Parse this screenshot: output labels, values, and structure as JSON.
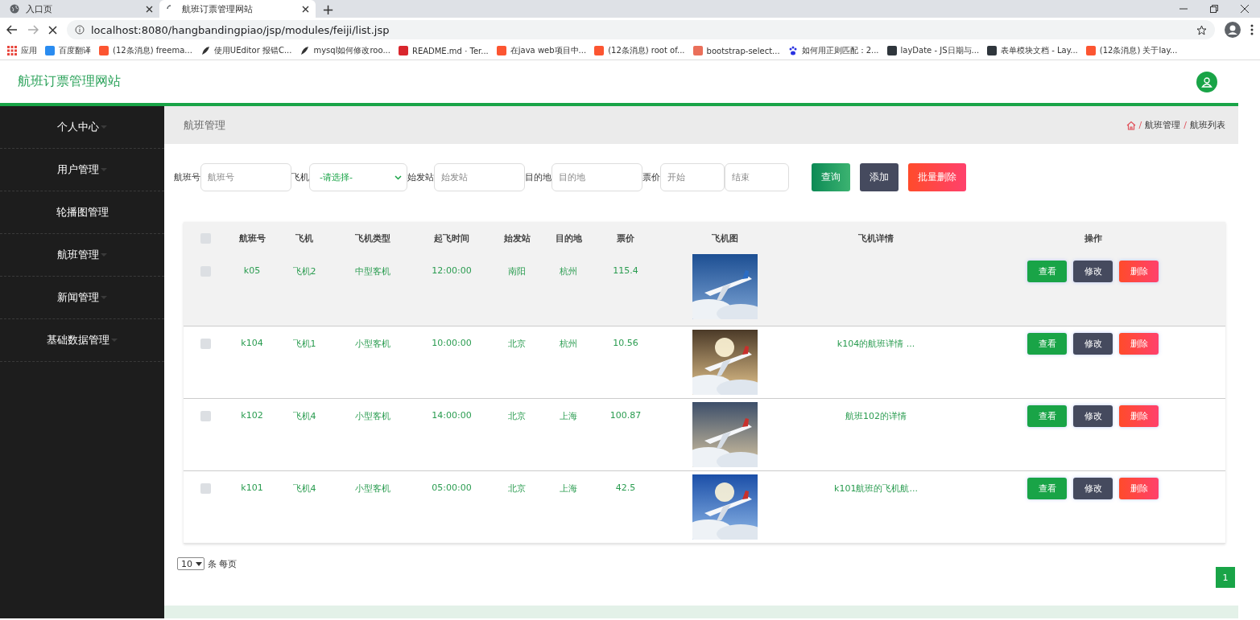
{
  "browser": {
    "tabs": [
      {
        "title": "入口页",
        "selected": false,
        "kind": "globe"
      },
      {
        "title": "航班订票管理网站",
        "selected": true,
        "kind": "loading"
      }
    ],
    "new_tab": "+",
    "address": "localhost:8080/hangbandingpiao/jsp/modules/feiji/list.jsp",
    "bookmarks": [
      {
        "title": "应用",
        "kind": "apps",
        "color": "#e8453c"
      },
      {
        "title": "百度翻译",
        "kind": "site",
        "color": "#2a8cf0"
      },
      {
        "title": "(12条消息) freema...",
        "kind": "site",
        "color": "#fc5531"
      },
      {
        "title": "使用UEditor 报错C...",
        "kind": "feather",
        "color": "#333333"
      },
      {
        "title": "mysql如何修改roo...",
        "kind": "feather",
        "color": "#333333"
      },
      {
        "title": "README.md · Ter...",
        "kind": "site",
        "color": "#d9262d"
      },
      {
        "title": "在java web项目中...",
        "kind": "site",
        "color": "#fc5531"
      },
      {
        "title": "(12条消息) root of...",
        "kind": "site",
        "color": "#fc5531"
      },
      {
        "title": "bootstrap-select...",
        "kind": "site",
        "color": "#ea6f5a"
      },
      {
        "title": "如何用正则匹配：2...",
        "kind": "paw",
        "color": "#2932e1"
      },
      {
        "title": "layDate - JS日期与...",
        "kind": "site",
        "color": "#2f363c"
      },
      {
        "title": "表单模块文档 - Lay...",
        "kind": "site",
        "color": "#2f363c"
      },
      {
        "title": "(12条消息) 关于lay...",
        "kind": "site",
        "color": "#fc5531"
      }
    ]
  },
  "header": {
    "title": "航班订票管理网站"
  },
  "sidebar": {
    "items": [
      {
        "label": "个人中心",
        "expandable": true
      },
      {
        "label": "用户管理",
        "expandable": true
      },
      {
        "label": "轮播图管理",
        "expandable": false
      },
      {
        "label": "航班管理",
        "expandable": true
      },
      {
        "label": "新闻管理",
        "expandable": true
      },
      {
        "label": "基础数据管理",
        "expandable": true
      }
    ]
  },
  "page_title": "航班管理",
  "breadcrumb": [
    {
      "kind": "sep",
      "text": "/"
    },
    {
      "kind": "link",
      "text": "航班管理"
    },
    {
      "kind": "sep",
      "text": "/"
    },
    {
      "kind": "link",
      "text": "航班列表"
    }
  ],
  "search": {
    "fields": [
      {
        "label": "航班号",
        "kind": "input",
        "placeholder": "航班号"
      },
      {
        "label": "飞机",
        "kind": "select",
        "value": "-请选择-"
      },
      {
        "label": "始发站",
        "kind": "input",
        "placeholder": "始发站"
      },
      {
        "label": "目的地",
        "kind": "input",
        "placeholder": "目的地"
      },
      {
        "label": "票价",
        "kind": "input",
        "placeholder": "开始"
      },
      {
        "kind": "input",
        "placeholder": "结束"
      }
    ],
    "buttons": [
      {
        "label": "查询",
        "kind": "primary"
      },
      {
        "label": "添加",
        "kind": "dark"
      },
      {
        "label": "批量删除",
        "kind": "danger"
      }
    ]
  },
  "table": {
    "header_checked": false,
    "columns": [
      "航班号",
      "飞机",
      "飞机类型",
      "起飞时间",
      "始发站",
      "目的地",
      "票价",
      "飞机图",
      "飞机详情",
      "操作"
    ],
    "rows": [
      {
        "checked": false,
        "hovered": true,
        "cells": [
          "k05",
          "飞机2",
          "中型客机",
          "12:00:00",
          "南阳",
          "杭州",
          "115.4"
        ],
        "detail": "",
        "actions": [
          "查看",
          "修改",
          "删除"
        ]
      },
      {
        "checked": false,
        "hovered": false,
        "cells": [
          "k104",
          "飞机1",
          "小型客机",
          "10:00:00",
          "北京",
          "杭州",
          "10.56"
        ],
        "detail": "k104的航班详情 ...",
        "actions": [
          "查看",
          "修改",
          "删除"
        ]
      },
      {
        "checked": false,
        "hovered": false,
        "cells": [
          "k102",
          "飞机4",
          "小型客机",
          "14:00:00",
          "北京",
          "上海",
          "100.87"
        ],
        "detail": "航班102的详情",
        "actions": [
          "查看",
          "修改",
          "删除"
        ]
      },
      {
        "checked": false,
        "hovered": false,
        "cells": [
          "k101",
          "飞机4",
          "小型客机",
          "05:00:00",
          "北京",
          "上海",
          "42.5"
        ],
        "detail": "k101航班的飞机航...",
        "actions": [
          "查看",
          "修改",
          "删除"
        ]
      }
    ]
  },
  "pagination": {
    "page_size": "10",
    "page_size_label": "条 每页",
    "pages": [
      {
        "label": "1",
        "selected": true
      }
    ]
  }
}
